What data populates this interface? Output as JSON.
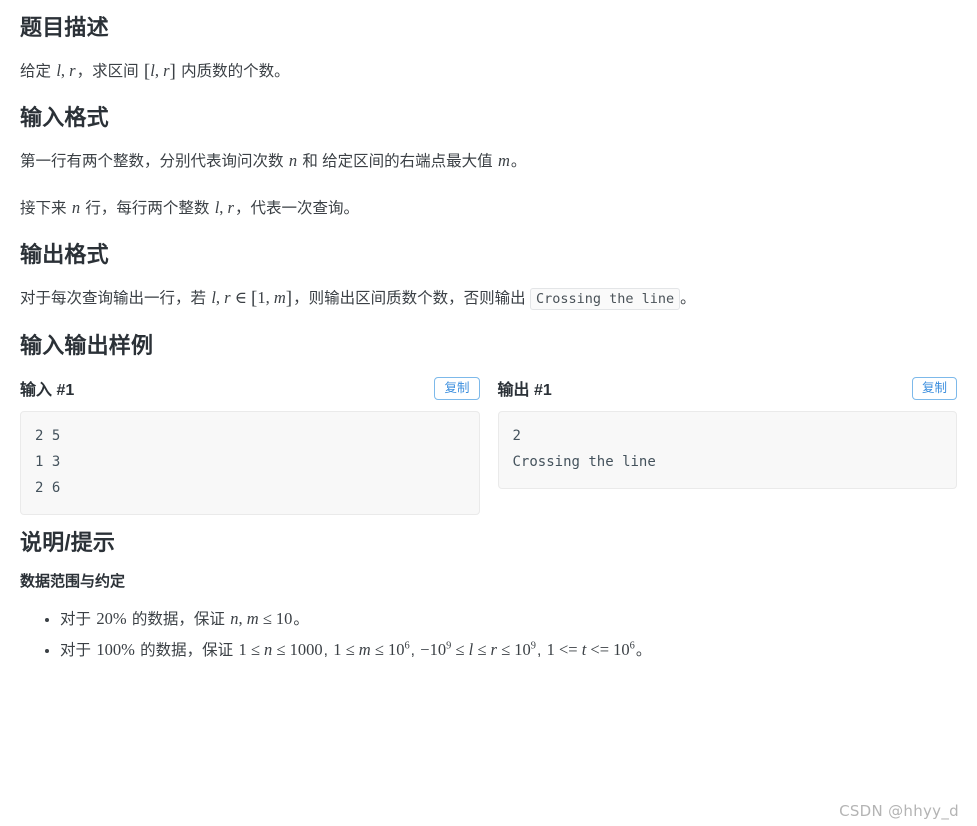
{
  "sections": {
    "description": {
      "title": "题目描述",
      "paragraph_prefix": "给定 ",
      "paragraph_mid": "，求区间 ",
      "paragraph_suffix": " 内质数的个数。",
      "math_lr": "l, r",
      "math_interval": "[l, r]"
    },
    "input_format": {
      "title": "输入格式",
      "line1_a": "第一行有两个整数，分别代表询问次数 ",
      "line1_b": " 和 给定区间的右端点最大值 ",
      "line1_c": "。",
      "var_n": "n",
      "var_m": "m",
      "line2_a": "接下来 ",
      "line2_b": " 行，每行两个整数 ",
      "line2_c": "，代表一次查询。",
      "var_n2": "n",
      "var_lr": "l, r"
    },
    "output_format": {
      "title": "输出格式",
      "text_a": "对于每次查询输出一行，若 ",
      "math_membership": "l, r ∈ [1, m]",
      "text_b": "，则输出区间质数个数，否则输出 ",
      "code": "Crossing the line",
      "text_c": "。"
    },
    "samples": {
      "title": "输入输出样例",
      "copy_label": "复制",
      "items": [
        {
          "label": "输入 #1",
          "content": "2 5\n1 3\n2 6"
        },
        {
          "label": "输出 #1",
          "content": "2\nCrossing the line"
        }
      ]
    },
    "hint": {
      "title": "说明/提示",
      "subtitle": "数据范围与约定",
      "bullets": [
        {
          "prefix": "对于 ",
          "percent": "20%",
          "mid": " 的数据，保证 ",
          "constraint": "n, m ≤ 10",
          "suffix": "。"
        },
        {
          "prefix": "对于 ",
          "percent": "100%",
          "mid": " 的数据，保证 ",
          "constraint": "1 ≤ n ≤ 1000, 1 ≤ m ≤ 10^6, −10^9 ≤ l ≤ r ≤ 10^9, 1 <= t <= 10^6",
          "suffix": "。"
        }
      ]
    }
  },
  "watermark": "CSDN @hhyy_d",
  "colors": {
    "heading": "#2b3137",
    "body": "#3b4045",
    "accent": "#3b8ede",
    "code_bg": "#f8f8f8",
    "code_border": "#eaeaea"
  }
}
